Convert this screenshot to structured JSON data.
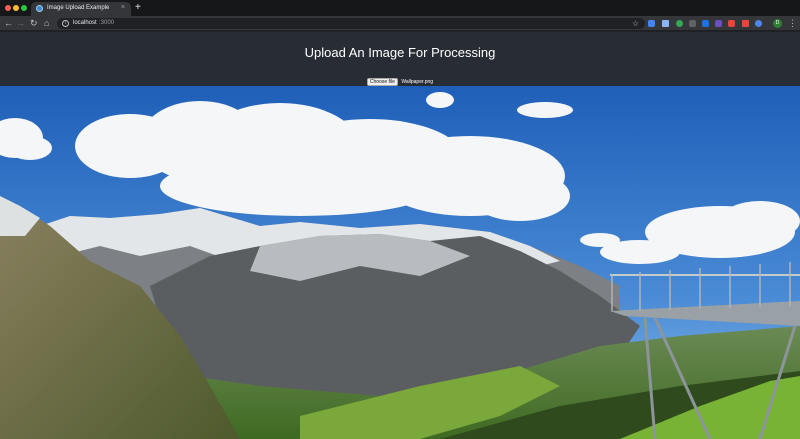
{
  "browser": {
    "tab_title": "Image Upload Example",
    "tab_close": "×",
    "new_tab": "+",
    "url_host": "localhost",
    "url_port": ":3000",
    "avatar_initial": "D"
  },
  "page": {
    "title": "Upload An Image For Processing",
    "file_input": {
      "button_label": "Choose file",
      "file_name": "Wallpaper.png"
    }
  },
  "image": {
    "subject": "Alpine mountain landscape with clouds and a cliff walkway",
    "sky_top": "#1f5fb8",
    "sky_bottom": "#6aa6e0",
    "cloud_color": "#f4f6f8",
    "mountain_dark": "#4a4f52",
    "snow_color": "#eef1f4",
    "meadow_color": "#5e8a2a"
  },
  "icons": [
    "back-icon",
    "forward-icon",
    "reload-icon",
    "home-icon",
    "info-icon",
    "star-icon",
    "extension-icon",
    "avatar",
    "menu-icon",
    "close-icon"
  ]
}
